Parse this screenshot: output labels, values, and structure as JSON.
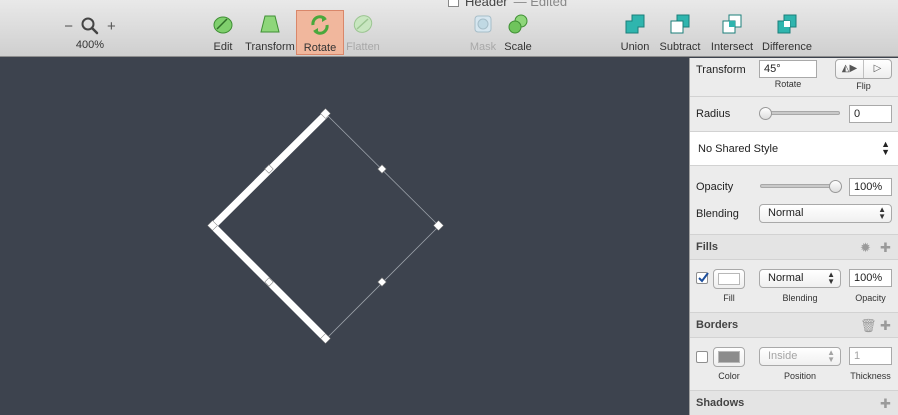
{
  "document": {
    "title": "Header",
    "status": "— Edited"
  },
  "zoom": {
    "minus": "−",
    "plus": "+",
    "value": "400%"
  },
  "toolbar": {
    "edit": "Edit",
    "transform": "Transform",
    "rotate": "Rotate",
    "flatten": "Flatten",
    "mask": "Mask",
    "scale": "Scale",
    "union": "Union",
    "subtract": "Subtract",
    "intersect": "Intersect",
    "difference": "Difference"
  },
  "colors": {
    "accent_green": "#5cb85c",
    "boolean_teal": "#27a9a3",
    "active_tool": "#f1b79d",
    "canvas": "#3d434e"
  },
  "inspector": {
    "transform": {
      "label": "Transform",
      "rotate_value": "45°",
      "rotate_caption": "Rotate",
      "flip_caption": "Flip"
    },
    "radius": {
      "label": "Radius",
      "value": "0"
    },
    "shared_style": {
      "value": "No Shared Style"
    },
    "opacity": {
      "label": "Opacity",
      "value": "100%",
      "level": 1.0
    },
    "blending": {
      "label": "Blending",
      "value": "Normal"
    },
    "fills": {
      "title": "Fills",
      "enabled": true,
      "blend_value": "Normal",
      "opacity_value": "100%",
      "fill_caption": "Fill",
      "blending_caption": "Blending",
      "opacity_caption": "Opacity",
      "fill_color": "#ffffff"
    },
    "borders": {
      "title": "Borders",
      "enabled": false,
      "position_value": "Inside",
      "thickness_value": "1",
      "color_caption": "Color",
      "position_caption": "Position",
      "thickness_caption": "Thickness",
      "border_color": "#8c8c8c"
    },
    "shadows": {
      "title": "Shadows"
    }
  }
}
